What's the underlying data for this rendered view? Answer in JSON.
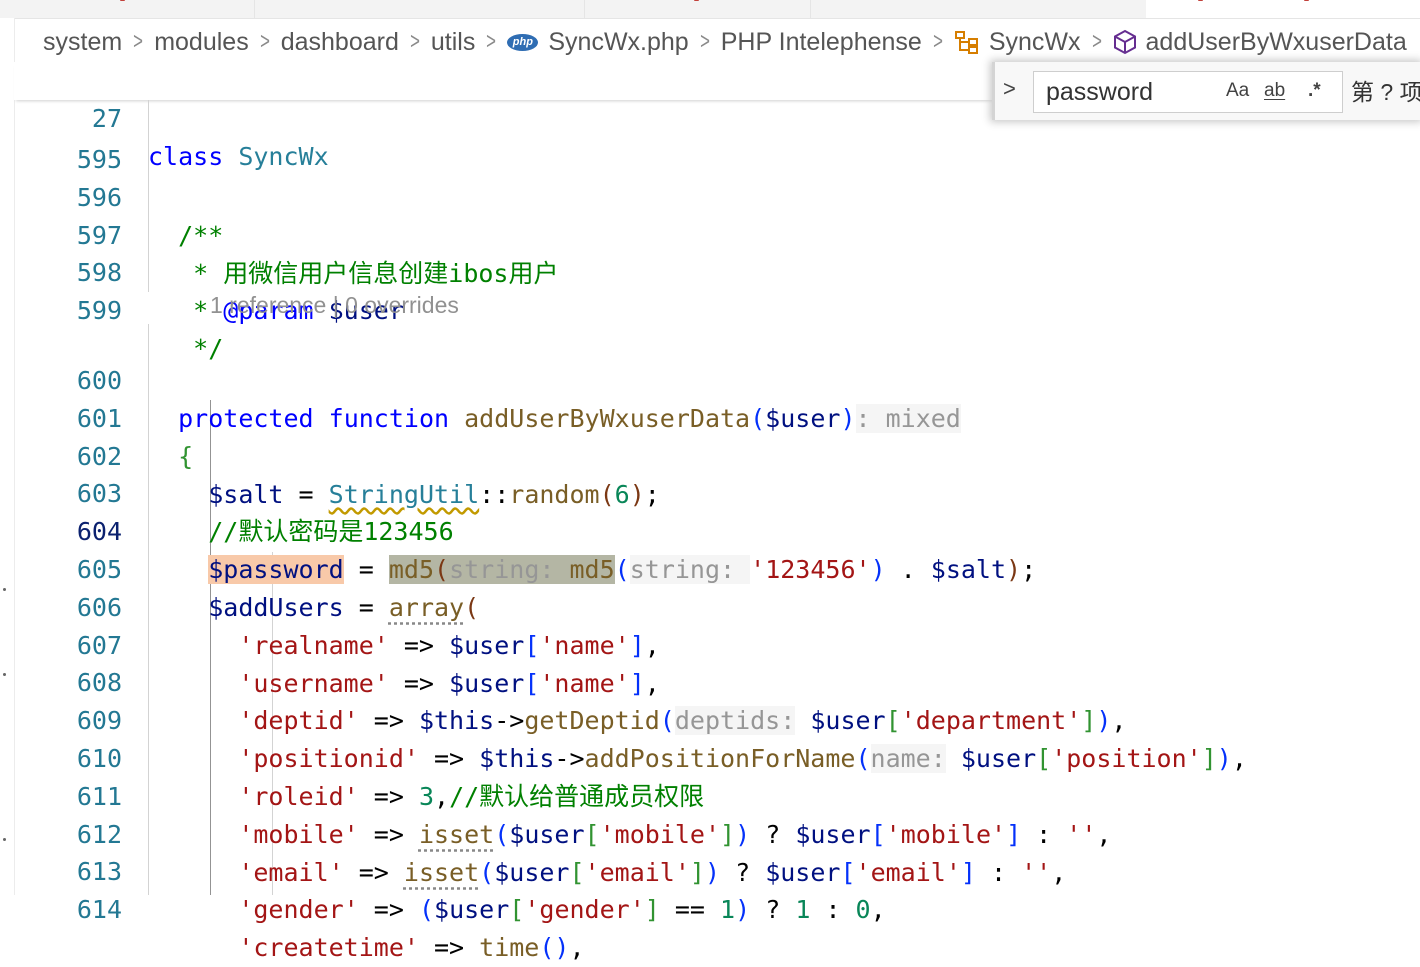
{
  "breadcrumb": {
    "items": [
      "system",
      "modules",
      "dashboard",
      "utils",
      "SyncWx.php",
      "PHP Intelephense",
      "SyncWx",
      "addUserByWxuserData"
    ],
    "file_icon_label": "php"
  },
  "sticky": {
    "line": "27",
    "keyword": "class",
    "name": "SyncWx"
  },
  "find": {
    "query": "password",
    "match_case": "Aa",
    "whole_word": "ab",
    "regex": ".*",
    "result": "第 ? 项"
  },
  "codelens": "1 reference | 0 overrides",
  "code": {
    "l595": "595",
    "l596": "596",
    "c596": "/**",
    "l597": "597",
    "c597": " * 用微信用户信息创建ibos用户",
    "l598": "598",
    "c598a": " * ",
    "c598b": "@param",
    "c598c": " $user",
    "l599": "599",
    "c599": " */",
    "l600": "600",
    "k_protected": "protected",
    "k_function": "function",
    "fn_name": "addUserByWxuserData",
    "param_user": "$user",
    "ret_hint": ": mixed",
    "l601": "601",
    "brace_open": "{",
    "l602": "602",
    "v_salt": "$salt",
    "t_stringutil": "StringUtil",
    "f_random": "random",
    "n_6": "6",
    "l603": "603",
    "c603": "//默认密码是123456",
    "l604": "604",
    "v_password": "$password",
    "f_md5": "md5",
    "hint_string": "string:",
    "s_123456": "'123456'",
    "l605": "605",
    "v_addusers": "$addUsers",
    "f_array": "array",
    "l606": "606",
    "s_realname": "'realname'",
    "s_name": "'name'",
    "l607": "607",
    "s_username": "'username'",
    "l608": "608",
    "s_deptid": "'deptid'",
    "v_this": "$this",
    "f_getdeptid": "getDeptid",
    "hint_deptids": "deptids:",
    "s_department": "'department'",
    "l609": "609",
    "s_positionid": "'positionid'",
    "f_addposition": "addPositionForName",
    "hint_name": "name:",
    "s_position": "'position'",
    "l610": "610",
    "s_roleid": "'roleid'",
    "n_3": "3",
    "c610": "//默认给普通成员权限",
    "l611": "611",
    "s_mobile": "'mobile'",
    "f_isset": "isset",
    "s_empty": "''",
    "l612": "612",
    "s_email": "'email'",
    "l613": "613",
    "s_gender": "'gender'",
    "n_1": "1",
    "n_0": "0",
    "l614": "614",
    "s_createtime": "'createtime'",
    "f_time": "time"
  }
}
